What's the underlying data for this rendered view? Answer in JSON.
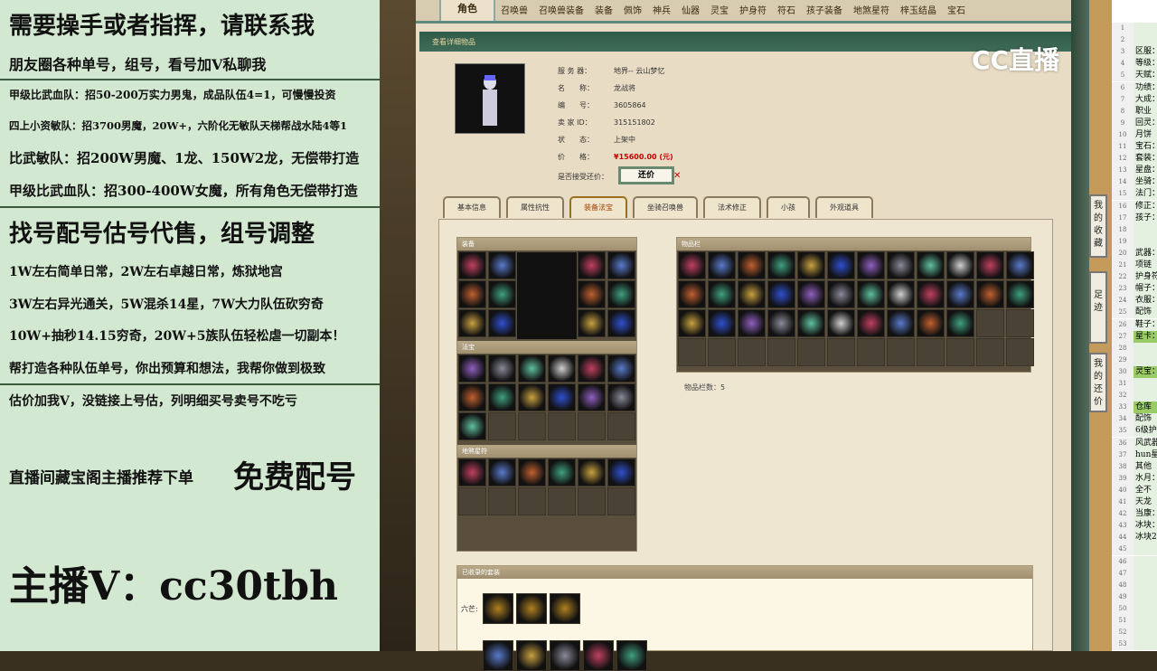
{
  "left": {
    "lines": [
      "需要操手或者指挥，请联系我",
      "朋友圈各种单号，组号，看号加V私聊我",
      "甲级比武血队：招50-200万实力男鬼，成品队伍4=1，可慢慢投资",
      "四上小资敏队：招3700男魔，20W+，六阶化无敏队天梯帮战水陆4等1",
      "比武敏队：招200W男魔、1龙、150W2龙，无偿带打造",
      "甲级比武血队：招300-400W女魔，所有角色无偿带打造",
      "找号配号估号代售，组号调整",
      "1W左右简单日常，2W左右卓越日常，炼狱地宫",
      "3W左右异光通关，5W混杀14星，7W大力队伍砍穷奇",
      "10W+抽秒14.15穷奇，20W+5族队伍轻松虐一切副本！",
      "帮打造各种队伍单号，你出预算和想法，我帮你做到极致",
      "估价加我V，没链接上号估，列明细买号卖号不吃亏",
      "直播间藏宝阁主播推荐下单",
      "免费配号",
      "主播V：cc30tbh"
    ]
  },
  "page": {
    "top_tabs": [
      "角色",
      "召唤兽",
      "召唤兽装备",
      "装备",
      "佩饰",
      "神兵",
      "仙器",
      "灵宝",
      "护身符",
      "符石",
      "孩子装备",
      "地煞星符",
      "梓玉结晶",
      "宝石"
    ],
    "header": "查看详细物品",
    "info": [
      {
        "k": "服 务 器：",
        "v": "地界-- 云山梦忆"
      },
      {
        "k": "名　　称：",
        "v": "龙战将"
      },
      {
        "k": "编　　号：",
        "v": "3605864"
      },
      {
        "k": "卖 家 ID：",
        "v": "315151802"
      },
      {
        "k": "状　　态：",
        "v": "上架中"
      },
      {
        "k": "价　　格：",
        "v": "¥15600.00 (元)"
      }
    ],
    "counter_label": "是否接受还价：",
    "counter_button": "还价",
    "sub_tabs": [
      "基本信息",
      "属性抗性",
      "装备法宝",
      "坐骑召唤兽",
      "法术修正",
      "小孩",
      "外观道具"
    ],
    "panels": {
      "equip": "装备",
      "fabao": "法宝",
      "dishasha": "地煞星符",
      "inventory": "物品栏",
      "collected": "已收录的套装"
    },
    "inventory_count": "物品栏数：5",
    "liumang_label": "六芒:"
  },
  "side_buttons": [
    "我的收藏",
    "足迹",
    "我的还价"
  ],
  "logo": "CC直播",
  "sheet": {
    "rows": [
      [
        "1",
        ""
      ],
      [
        "2",
        ""
      ],
      [
        "3",
        "区服："
      ],
      [
        "4",
        "等级："
      ],
      [
        "5",
        "天赋："
      ],
      [
        "6",
        "功绩："
      ],
      [
        "7",
        "大成："
      ],
      [
        "8",
        "职业"
      ],
      [
        "9",
        "回灵："
      ],
      [
        "10",
        "月饼"
      ],
      [
        "11",
        "宝石："
      ],
      [
        "12",
        "套装："
      ],
      [
        "13",
        "星盘："
      ],
      [
        "14",
        "坐骑："
      ],
      [
        "15",
        "法门："
      ],
      [
        "16",
        "修正："
      ],
      [
        "17",
        "孩子："
      ],
      [
        "18",
        ""
      ],
      [
        "19",
        ""
      ],
      [
        "20",
        "武器："
      ],
      [
        "21",
        "项链"
      ],
      [
        "22",
        "护身符"
      ],
      [
        "23",
        "帽子："
      ],
      [
        "24",
        "衣服："
      ],
      [
        "25",
        "配饰"
      ],
      [
        "26",
        "鞋子："
      ],
      [
        "27",
        "星卡："
      ],
      [
        "28",
        ""
      ],
      [
        "29",
        ""
      ],
      [
        "30",
        "灵宝："
      ],
      [
        "31",
        ""
      ],
      [
        "32",
        ""
      ],
      [
        "33",
        "仓库"
      ],
      [
        "34",
        "配饰"
      ],
      [
        "35",
        "6级护"
      ],
      [
        "36",
        "风武器"
      ],
      [
        "37",
        "hun星"
      ],
      [
        "38",
        "其他"
      ],
      [
        "39",
        "水月："
      ],
      [
        "40",
        "全不"
      ],
      [
        "41",
        "天龙"
      ],
      [
        "42",
        "当康："
      ],
      [
        "43",
        "冰块："
      ],
      [
        "44",
        "冰块2"
      ],
      [
        "45",
        ""
      ],
      [
        "46",
        ""
      ],
      [
        "47",
        ""
      ],
      [
        "48",
        ""
      ],
      [
        "49",
        ""
      ],
      [
        "50",
        ""
      ],
      [
        "51",
        ""
      ],
      [
        "52",
        ""
      ],
      [
        "53",
        ""
      ]
    ]
  }
}
